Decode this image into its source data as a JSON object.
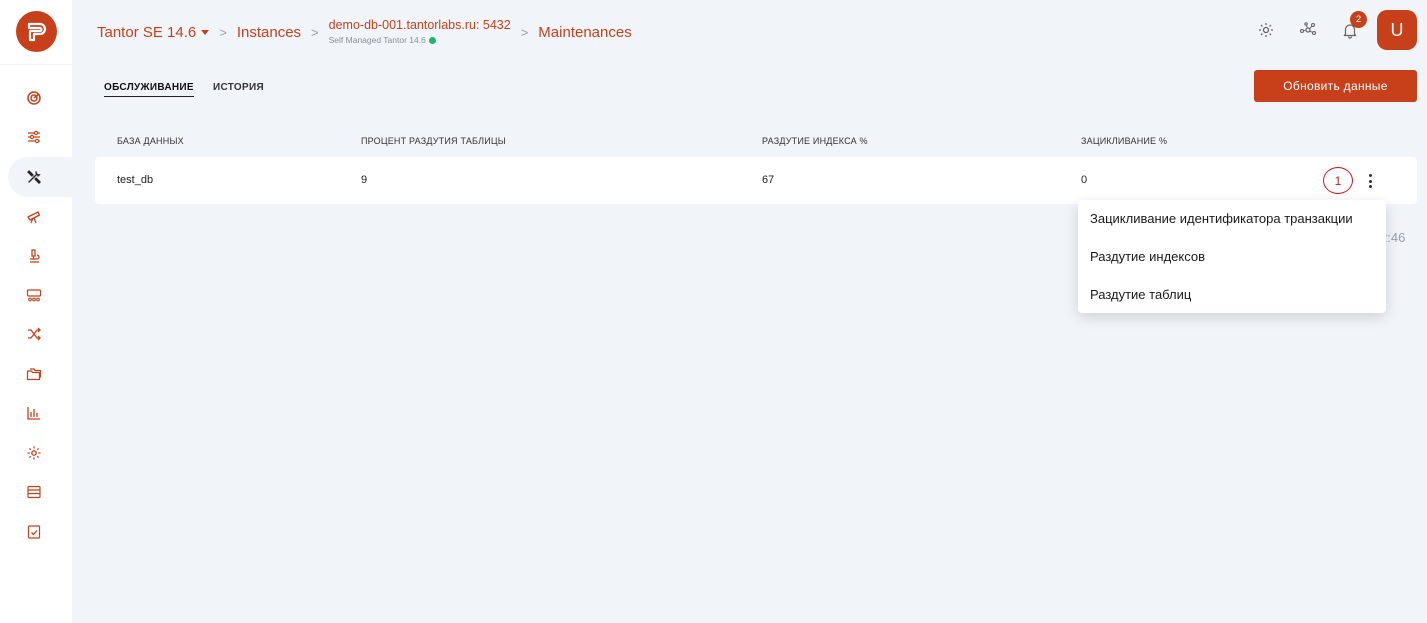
{
  "header": {
    "product": "Tantor SE 14.6",
    "instances": "Instances",
    "host": "demo-db-001.tantorlabs.ru: 5432",
    "host_sub": "Self Managed Tantor 14.6",
    "page": "Maintenances",
    "notifications_count": "2",
    "avatar_letter": "U"
  },
  "tabs": [
    {
      "label": "ОБСЛУЖИВАНИЕ",
      "active": true
    },
    {
      "label": "ИСТОРИЯ",
      "active": false
    }
  ],
  "refresh_label": "Обновить данные",
  "table": {
    "columns": [
      "БАЗА ДАННЫХ",
      "ПРОЦЕНТ РАЗДУТИЯ ТАБЛИЦЫ",
      "РАЗДУТИЕ ИНДЕКСА %",
      "ЗАЦИКЛИВАНИЕ %"
    ],
    "rows": [
      {
        "db": "test_db",
        "table_bloat": "9",
        "index_bloat": "67",
        "wraparound": "0"
      }
    ]
  },
  "annotation": "1",
  "obscured_time": "2:46",
  "menu": {
    "items": [
      "Зацикливание идентификатора транзакции",
      "Раздутие индексов",
      "Раздутие таблиц"
    ]
  },
  "sidebar": {
    "icons": [
      "dashboard-icon",
      "sliders-icon",
      "tools-icon",
      "telescope-icon",
      "microscope-icon",
      "sessions-icon",
      "shuffle-icon",
      "folders-icon",
      "bar-chart-icon",
      "gear-icon",
      "storage-icon",
      "checklist-icon"
    ],
    "active_index": 2
  },
  "colors": {
    "accent": "#c8401a",
    "background": "#f1f4f9"
  }
}
